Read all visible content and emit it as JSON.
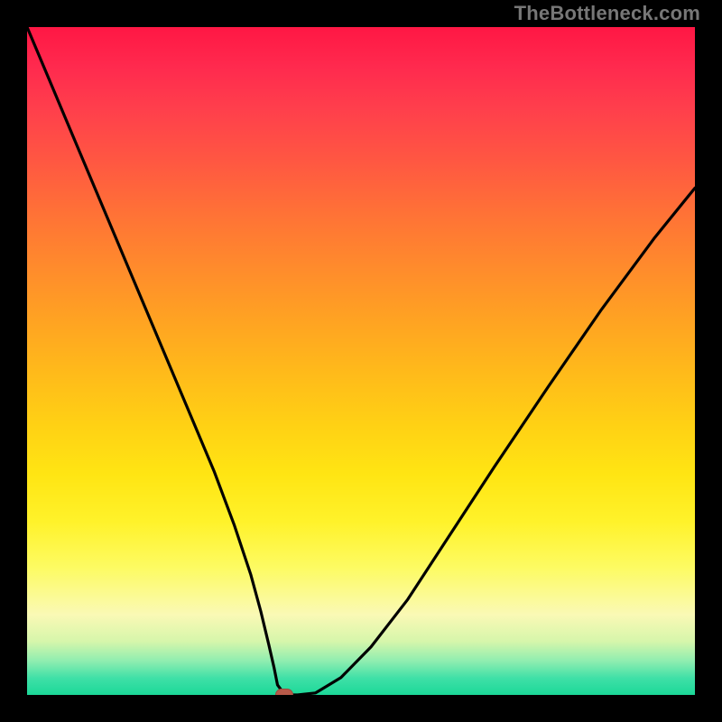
{
  "watermark": "TheBottleneck.com",
  "chart_data": {
    "type": "line",
    "title": "",
    "xlabel": "",
    "ylabel": "",
    "xlim": [
      0,
      100
    ],
    "ylim": [
      0,
      100
    ],
    "grid": false,
    "legend": false,
    "series": [
      {
        "name": "bottleneck-curve",
        "x": [
          0,
          4,
          8,
          12,
          16,
          20,
          24,
          28,
          31,
          33.5,
          35,
          36.2,
          37,
          37.5,
          38.6,
          40.5,
          43.2,
          47,
          51.5,
          57,
          63,
          70,
          78,
          86,
          94,
          100
        ],
        "y": [
          100,
          90.5,
          81,
          71.5,
          62,
          52.5,
          43,
          33.5,
          25.5,
          18,
          12.5,
          7.5,
          4,
          1.5,
          0,
          0,
          0.3,
          2.6,
          7.2,
          14.3,
          23.5,
          34.2,
          46.1,
          57.7,
          68.5,
          75.9
        ]
      }
    ],
    "marker": {
      "x": 38.5,
      "y": 0
    },
    "gradient_stops_pct": {
      "red": 0,
      "orange": 40,
      "yellow": 70,
      "pale_yellow": 88,
      "green": 100
    }
  }
}
